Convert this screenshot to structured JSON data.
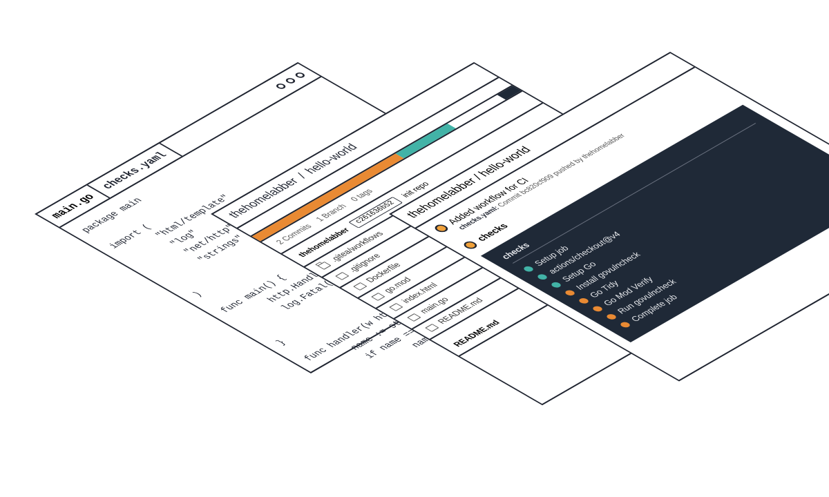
{
  "diagram": {
    "description": "Three isometric stacked windows showing a code editor, a git repository browser, and a CI pipeline run."
  },
  "editor": {
    "tabs": {
      "active": "main.go",
      "inactive": "checks.yaml"
    },
    "code": "package main\n\nimport (\n       \"html/template\"\n       \"log\"\n       \"net/http\"\n       \"strings\"\n\n)\n\nfunc main() {\n       http.HandleFunc(\"/\", han\n       log.Fatal(http.ListenAnd\n\n}\n\nfunc handler(w http.ResponseWri\n       name := strings.Replace(\n       if name == \"\" {\n              name = \"World\"\n"
  },
  "repo": {
    "owner": "thehomelabber",
    "name": "hello-world",
    "stats": {
      "commits_label": "2 Commits",
      "branches_label": "1 Branch",
      "tags_label": "0 tags"
    },
    "last_commit": {
      "author": "thehomelabber",
      "sha": "c261636b52",
      "message": "init repo"
    },
    "files": [
      {
        "name": ".gitea/workflows",
        "type": "dir"
      },
      {
        "name": ".gitignore",
        "type": "file"
      },
      {
        "name": "Dockerfile",
        "type": "file"
      },
      {
        "name": "go.mod",
        "type": "file"
      },
      {
        "name": "index.html",
        "type": "file"
      },
      {
        "name": "main.go",
        "type": "file"
      },
      {
        "name": "README.md",
        "type": "file"
      }
    ],
    "readme_heading": "README.md"
  },
  "ci": {
    "owner": "thehomelabber",
    "name": "hello-world",
    "run": {
      "title": "Added workflow for CI",
      "subline_prefix_bold": "checks.yaml:",
      "subline_rest": " Commit bc820cf909 pushed by thehomelabber",
      "job_label": "checks"
    },
    "terminal": {
      "heading": "checks",
      "steps": [
        {
          "status": "teal",
          "label": "Setup job"
        },
        {
          "status": "teal",
          "label": "actions/checkout@v4"
        },
        {
          "status": "teal",
          "label": "Setup Go"
        },
        {
          "status": "orange",
          "label": "Install govulncheck"
        },
        {
          "status": "orange",
          "label": "Go Tidy"
        },
        {
          "status": "orange",
          "label": "Go Mod Verify"
        },
        {
          "status": "orange",
          "label": "Run govulncheck"
        },
        {
          "status": "orange",
          "label": "Complete job"
        }
      ]
    }
  },
  "colors": {
    "ink": "#1f2430",
    "orange": "#e98a33",
    "teal": "#42b3a7",
    "terminal_bg": "#1f2937",
    "amber_bullet": "#f0a13b"
  }
}
